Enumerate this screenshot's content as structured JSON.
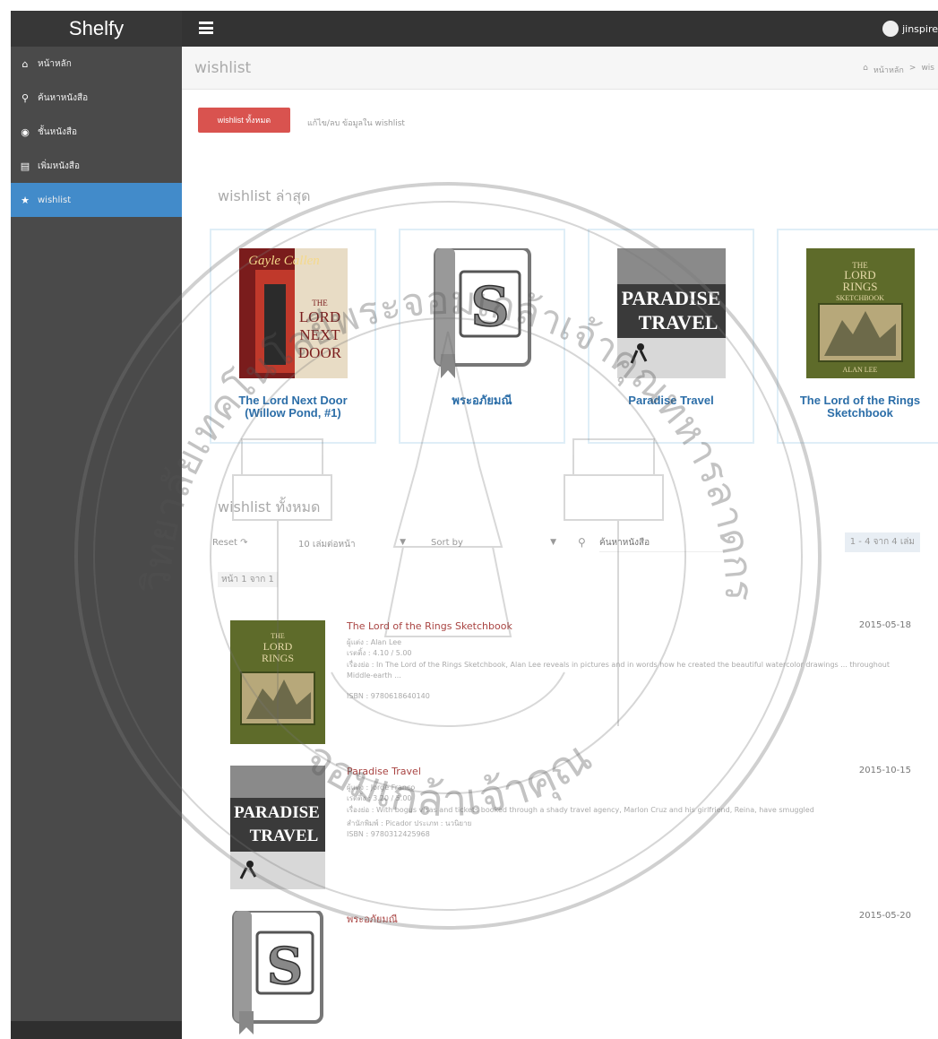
{
  "app": {
    "brand": "Shelfy",
    "user_name": "jinspire"
  },
  "sidebar": {
    "items": [
      {
        "label": "หน้าหลัก",
        "icon": "home-icon"
      },
      {
        "label": "ค้นหาหนังสือ",
        "icon": "search-icon"
      },
      {
        "label": "ชั้นหนังสือ",
        "icon": "globe-icon"
      },
      {
        "label": "เพิ่มหนังสือ",
        "icon": "book-icon"
      },
      {
        "label": "wishlist",
        "icon": "star-icon",
        "active": true
      }
    ]
  },
  "header": {
    "title": "wishlist",
    "breadcrumb": [
      "หน้าหลัก",
      ">",
      "wis"
    ]
  },
  "actions": {
    "all_button": "wishlist ทั้งหมด",
    "edit_link": "แก้ไข/ลบ ข้อมูลใน wishlist"
  },
  "latest": {
    "title": "wishlist ล่าสุด",
    "cards": [
      {
        "title": "The Lord Next Door (Willow Pond, #1)",
        "cover_text": [
          "Gayle Callen",
          "THE",
          "LORD",
          "NEXT",
          "DOOR"
        ]
      },
      {
        "title": "พระอภัยมณี",
        "cover_text": [
          "S"
        ]
      },
      {
        "title": "Paradise Travel",
        "cover_text": [
          "PARADISE",
          "TRAVEL"
        ]
      },
      {
        "title": "The Lord of the Rings Sketchbook",
        "cover_text": [
          "THE",
          "LORD",
          "RINGS",
          "SKETCHBOOK",
          "ALAN LEE"
        ]
      }
    ]
  },
  "all": {
    "title": "wishlist ทั้งหมด",
    "reset": "Reset",
    "per_page": "10 เล่มต่อหน้า",
    "sort_by": "Sort by",
    "search_placeholder": "ค้นหาหนังสือ",
    "count": "1 - 4 จาก 4 เล่ม",
    "page_of": "หน้า 1 จาก 1",
    "items": [
      {
        "title": "The Lord of the Rings Sketchbook",
        "date": "2015-05-18",
        "author": "ผู้แต่ง : Alan Lee",
        "rating": "เรตติ้ง : 4.10 / 5.00",
        "desc": "เรื่องย่อ : In The Lord of the Rings Sketchbook, Alan Lee reveals in pictures and in words how he created the beautiful watercolor drawings ... throughout Middle-earth ...",
        "isbn": "ISBN : 9780618640140"
      },
      {
        "title": "Paradise Travel",
        "date": "2015-10-15",
        "author": "ผู้แต่ง : Jorge Franco",
        "rating": "เรตติ้ง : 3.20 / 5.00",
        "desc": "เรื่องย่อ : With bogus visas and tickets booked through a shady travel agency, Marlon Cruz and his girlfriend, Reina, have smuggled",
        "publisher": "สำนักพิมพ์ : Picador     ประเภท : นวนิยาย",
        "isbn": "ISBN : 9780312425968"
      },
      {
        "title": "พระอภัยมณี",
        "date": "2015-05-20"
      }
    ]
  },
  "watermark": {
    "top_text": "มหาวิทยาลัยเทคโนโลยีพระจอมเกล้าเจ้าคุณทหารลาดกระบัง",
    "bottom_text": "จอมเกล้าเจ้าคุณ"
  },
  "colors": {
    "topbar": "#333333",
    "sidebar": "#4a4a4a",
    "active": "#428bca",
    "danger": "#d9534f",
    "card_title": "#2c6ea8",
    "item_title": "#a94442"
  }
}
